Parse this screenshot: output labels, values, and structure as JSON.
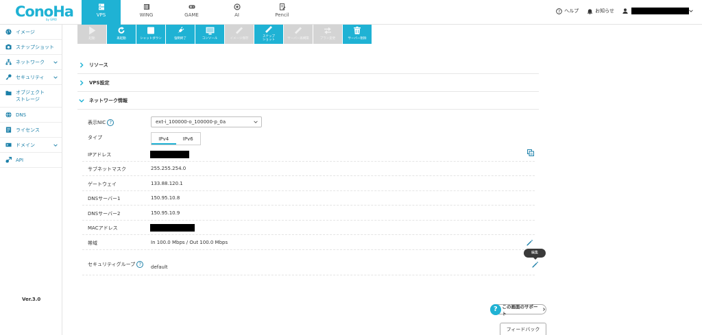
{
  "app": {
    "logo": "ConoHa",
    "logo_sub": "by GMO"
  },
  "topnav": [
    {
      "label": "VPS",
      "icon": "server-icon",
      "active": true
    },
    {
      "label": "WING",
      "icon": "server-stack-icon",
      "active": false
    },
    {
      "label": "GAME",
      "icon": "gamepad-icon",
      "active": false
    },
    {
      "label": "AI",
      "icon": "ai-chip-icon",
      "active": false
    },
    {
      "label": "Pencil",
      "icon": "pencil-doc-icon",
      "active": false
    }
  ],
  "topright": {
    "help": "ヘルプ",
    "notice": "お知らせ"
  },
  "sidebar": {
    "items": [
      {
        "label": "イメージ",
        "icon": "globe-icon"
      },
      {
        "label": "スナップショット",
        "icon": "snapshot-icon"
      },
      {
        "label": "ネットワーク",
        "icon": "network-icon",
        "expandable": true
      },
      {
        "label": "セキュリティ",
        "icon": "key-icon",
        "expandable": true
      },
      {
        "label": "オブジェクトストレージ",
        "label_l1": "オブジェクト",
        "label_l2": "ストレージ",
        "icon": "folder-icon"
      },
      {
        "label": "DNS",
        "icon": "dns-globe-icon"
      },
      {
        "label": "ライセンス",
        "icon": "license-icon"
      },
      {
        "label": "ドメイン",
        "icon": "domain-tag-icon",
        "expandable": true
      },
      {
        "label": "API",
        "icon": "api-icon"
      }
    ],
    "version": "Ver.3.0"
  },
  "toolbar": [
    {
      "label": "起動",
      "enabled": false,
      "icon": "play-icon"
    },
    {
      "label": "再起動",
      "enabled": true,
      "icon": "restart-icon"
    },
    {
      "label": "シャットダウン",
      "enabled": true,
      "icon": "stop-icon"
    },
    {
      "label": "強制終了",
      "enabled": true,
      "icon": "plug-icon"
    },
    {
      "label": "コンソール",
      "enabled": true,
      "icon": "console-icon"
    },
    {
      "label": "イメージ保存",
      "enabled": false,
      "icon": "save-image-icon"
    },
    {
      "label": "スナップショット",
      "label_l1": "スナップ",
      "label_l2": "ショット",
      "enabled": true,
      "icon": "snapshot-tool-icon"
    },
    {
      "label": "サーバー再構築",
      "enabled": false,
      "icon": "rebuild-icon"
    },
    {
      "label": "プラン変更",
      "enabled": false,
      "icon": "plan-change-icon"
    },
    {
      "label": "サーバー削除",
      "enabled": true,
      "icon": "trash-icon"
    }
  ],
  "sections": {
    "resource": "リソース",
    "vps_settings": "VPS設定",
    "network_info": "ネットワーク情報"
  },
  "network": {
    "nic_label": "表示NIC",
    "nic_value": "ext-i_100000-o_100000-p_0a",
    "type_label": "タイプ",
    "tabs": [
      "IPv4",
      "IPv6"
    ],
    "active_tab": "IPv4",
    "ip_label": "IPアドレス",
    "subnet_label": "サブネットマスク",
    "subnet_value": "255.255.254.0",
    "gateway_label": "ゲートウェイ",
    "gateway_value": "133.88.120.1",
    "dns1_label": "DNSサーバー1",
    "dns1_value": "150.95.10.8",
    "dns2_label": "DNSサーバー2",
    "dns2_value": "150.95.10.9",
    "mac_label": "MACアドレス",
    "bandwidth_label": "帯域",
    "bandwidth_value": "In 100.0 Mbps / Out 100.0 Mbps",
    "secgroup_label": "セキュリティグループ",
    "secgroup_value": "default",
    "tooltip": "編集"
  },
  "footer": {
    "support": "この画面のサポート",
    "feedback": "フィードバック"
  },
  "colors": {
    "accent": "#1fb2d4",
    "link": "#1a7fa8",
    "disabled": "#d4d4d4"
  }
}
